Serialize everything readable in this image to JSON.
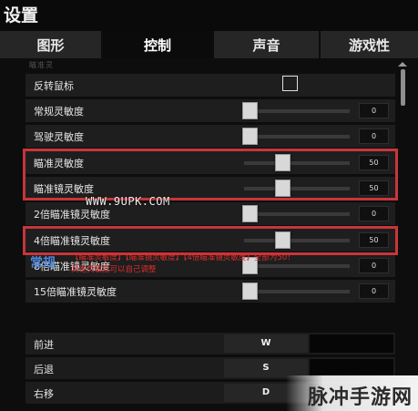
{
  "window": {
    "title": "设置"
  },
  "tabs": [
    {
      "label": "图形",
      "active": false
    },
    {
      "label": "控制",
      "active": true
    },
    {
      "label": "声音",
      "active": false
    },
    {
      "label": "游戏性",
      "active": false
    }
  ],
  "settings": {
    "cut_label": "瞄准灵",
    "invert_mouse": {
      "label": "反转鼠标",
      "checked": false
    },
    "general_sensitivity": {
      "label": "常规灵敏度",
      "value": "0",
      "level": 0
    },
    "vehicle_sensitivity": {
      "label": "驾驶灵敏度",
      "value": "0",
      "level": 0
    },
    "aim_sensitivity": {
      "label": "瞄准灵敏度",
      "value": "50",
      "level": 50
    },
    "scope_sensitivity": {
      "label": "瞄准镜灵敏度",
      "value": "50",
      "level": 50
    },
    "scope_2x_sensitivity": {
      "label": "2倍瞄准镜灵敏度",
      "value": "0",
      "level": 0
    },
    "scope_4x_sensitivity": {
      "label": "4倍瞄准镜灵敏度",
      "value": "50",
      "level": 50
    },
    "scope_8x_sensitivity": {
      "label": "8倍瞄准镜灵敏度",
      "value": "0",
      "level": 0
    },
    "scope_15x_sensitivity": {
      "label": "15倍瞄准镜灵敏度",
      "value": "0",
      "level": 0
    }
  },
  "watermark": "WWW.9UPK.COM",
  "keybinds": {
    "section_title": "常规",
    "note_line1": "【瞄准灵敏度】【瞄准镜灵敏度】【4倍瞄准镜灵敏度】全部为50！",
    "note_line2": "其他灵敏度可以自己调整",
    "rows": [
      {
        "label": "前进",
        "key": "W"
      },
      {
        "label": "后退",
        "key": "S"
      },
      {
        "label": "右移",
        "key": "D"
      }
    ]
  },
  "corner_logo": "脉冲手游网",
  "colors": {
    "highlight": "#c8353a",
    "section_title": "#4f86d6",
    "note_text": "#e02c2c"
  }
}
